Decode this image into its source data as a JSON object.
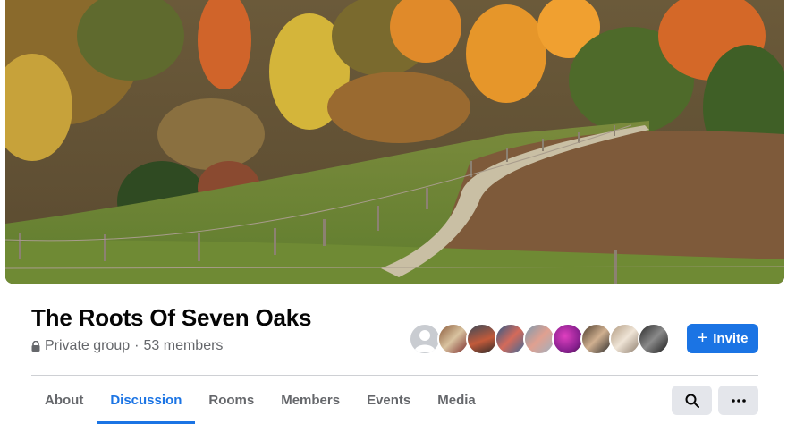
{
  "group": {
    "name": "The Roots Of Seven Oaks",
    "privacy": "Private group",
    "separator": "·",
    "members": "53 members"
  },
  "actions": {
    "invite_label": "Invite"
  },
  "tabs": [
    {
      "label": "About"
    },
    {
      "label": "Discussion"
    },
    {
      "label": "Rooms"
    },
    {
      "label": "Members"
    },
    {
      "label": "Events"
    },
    {
      "label": "Media"
    }
  ],
  "active_tab": "Discussion",
  "member_avatar_count": 9,
  "colors": {
    "accent": "#1b74e4",
    "secondary_text": "#65676b",
    "button_gray": "#e4e6eb"
  },
  "icons": {
    "privacy": "lock-icon",
    "invite": "plus-icon",
    "search": "search-icon",
    "more": "more-horizontal-icon"
  }
}
